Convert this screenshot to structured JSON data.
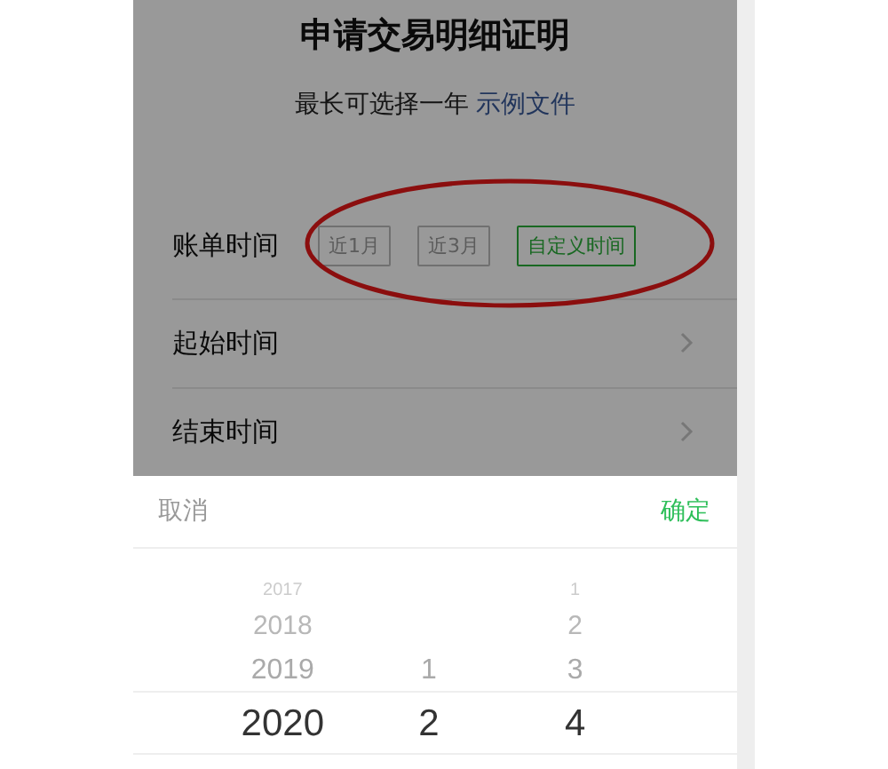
{
  "page": {
    "title": "申请交易明细证明",
    "subtitle": "最长可选择一年",
    "sample_link": "示例文件"
  },
  "bill_time": {
    "label": "账单时间",
    "options": [
      {
        "label": "近1月",
        "selected": false
      },
      {
        "label": "近3月",
        "selected": false
      },
      {
        "label": "自定义时间",
        "selected": true
      }
    ]
  },
  "rows": [
    {
      "label": "起始时间"
    },
    {
      "label": "结束时间"
    }
  ],
  "annotation": {
    "kind": "ellipse"
  },
  "picker": {
    "cancel": "取消",
    "confirm": "确定",
    "columns": [
      {
        "items": [
          {
            "label": "2017",
            "selected": false
          },
          {
            "label": "2018",
            "selected": false
          },
          {
            "label": "2019",
            "selected": false
          },
          {
            "label": "2020",
            "selected": true
          }
        ]
      },
      {
        "items": [
          {
            "label": "1",
            "selected": false
          },
          {
            "label": "2",
            "selected": true
          }
        ]
      },
      {
        "items": [
          {
            "label": "1",
            "selected": false
          },
          {
            "label": "2",
            "selected": false
          },
          {
            "label": "3",
            "selected": false
          },
          {
            "label": "4",
            "selected": true
          }
        ]
      }
    ]
  }
}
